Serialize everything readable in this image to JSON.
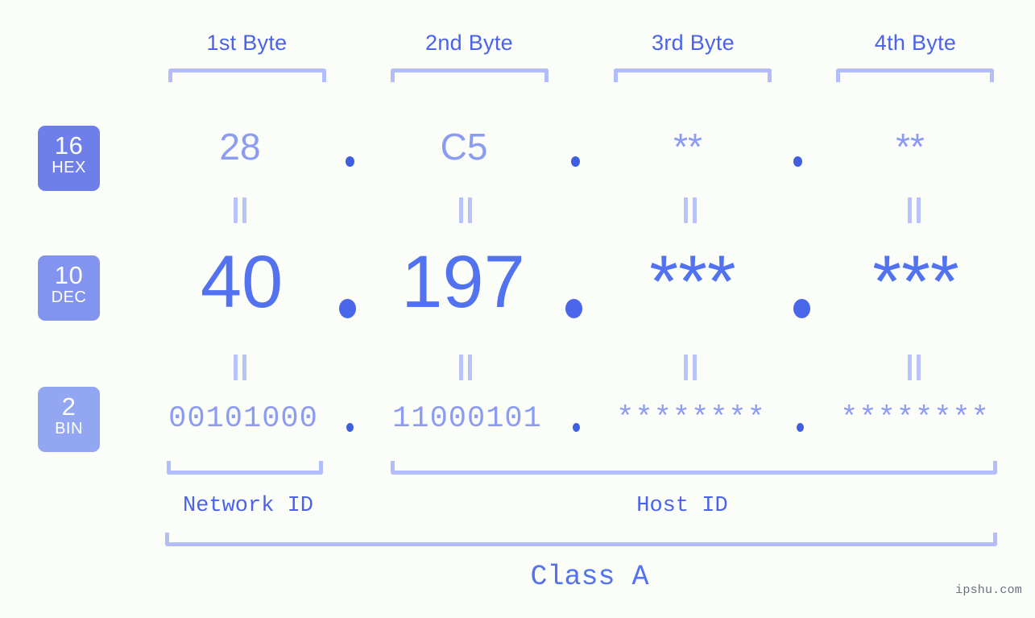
{
  "watermark": "ipshu.com",
  "byte_headers": [
    {
      "label": "1st Byte"
    },
    {
      "label": "2nd Byte"
    },
    {
      "label": "3rd Byte"
    },
    {
      "label": "4th Byte"
    }
  ],
  "bases": [
    {
      "num": "16",
      "name": "HEX",
      "color": "#6e7fe9"
    },
    {
      "num": "10",
      "name": "DEC",
      "color": "#8294ef"
    },
    {
      "num": "2",
      "name": "BIN",
      "color": "#92a6f2"
    }
  ],
  "rows": {
    "hex": {
      "values": [
        "28",
        "C5",
        "**",
        "**"
      ],
      "separator": "."
    },
    "dec": {
      "values": [
        "40",
        "197",
        "***",
        "***"
      ],
      "separator": "."
    },
    "bin": {
      "values": [
        "00101000",
        "11000101",
        "********",
        "********"
      ],
      "separator": "."
    }
  },
  "equals_glyph": "||",
  "footer": {
    "network_id": "Network ID",
    "host_id": "Host ID",
    "class": "Class A"
  },
  "colors": {
    "background": "#fbfdf8",
    "accent": "#4a63e8",
    "accent_light": "#8c9cf2",
    "bracket": "#b4bdfb",
    "dec_text": "#5272f0"
  }
}
